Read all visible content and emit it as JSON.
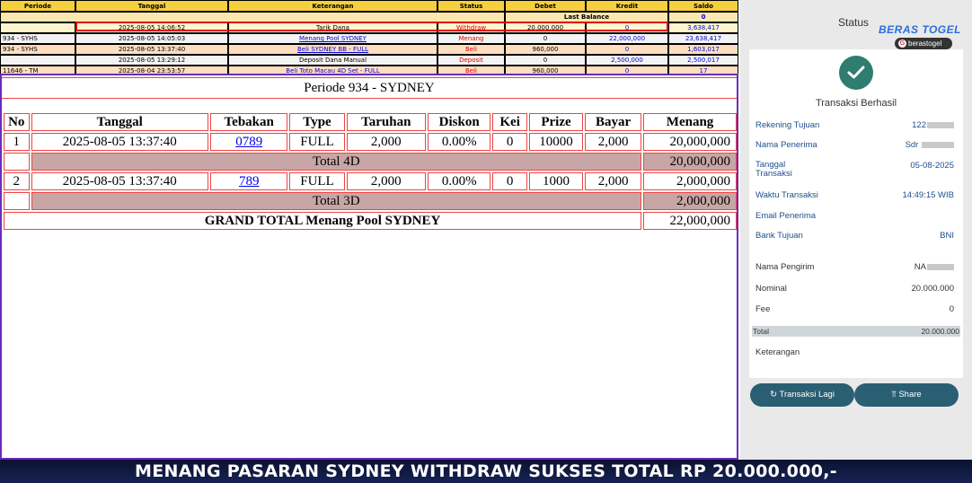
{
  "ledger": {
    "headers": [
      "Periode",
      "Tanggal",
      "Keterangan",
      "Status",
      "Debet",
      "Kredit",
      "Saldo"
    ],
    "last_balance_label": "Last Balance",
    "last_balance_value": "0",
    "rows": [
      {
        "periode": "",
        "tanggal": "2025-08-05 14:06:52",
        "keterangan": "Tarik Dana",
        "status": "Withdraw",
        "debet": "20,000,000",
        "kredit": "0",
        "saldo": "3,638,417"
      },
      {
        "periode": "934 - SYHS",
        "tanggal": "2025-08-05 14:05:03",
        "keterangan": "Menang Pool SYDNEY",
        "status": "Menang",
        "debet": "0",
        "kredit": "22,000,000",
        "saldo": "23,638,417"
      },
      {
        "periode": "934 - SYHS",
        "tanggal": "2025-08-05 13:37:40",
        "keterangan": "Beli SYDNEY BB - FULL",
        "status": "Beli",
        "debet": "960,000",
        "kredit": "0",
        "saldo": "1,603,017"
      },
      {
        "periode": "",
        "tanggal": "2025-08-05 13:29:12",
        "keterangan": "Deposit Dana Manual",
        "status": "Deposit",
        "debet": "0",
        "kredit": "2,500,000",
        "saldo": "2,500,017"
      },
      {
        "periode": "11646 - TM",
        "tanggal": "2025-08-04 23:53:57",
        "keterangan": "Beli Toto Macau 4D Set - FULL",
        "status": "Beli",
        "debet": "960,000",
        "kredit": "0",
        "saldo": "17"
      }
    ]
  },
  "report": {
    "title": "Periode 934 - SYDNEY",
    "headers": [
      "No",
      "Tanggal",
      "Tebakan",
      "Type",
      "Taruhan",
      "Diskon",
      "Kei",
      "Prize",
      "Bayar",
      "Menang"
    ],
    "row1": {
      "no": "1",
      "tanggal": "2025-08-05 13:37:40",
      "tebakan": "0789",
      "type": "FULL",
      "taruhan": "2,000",
      "diskon": "0.00%",
      "kei": "0",
      "prize": "10000",
      "bayar": "2,000",
      "menang": "20,000,000"
    },
    "total4d_label": "Total 4D",
    "total4d_value": "20,000,000",
    "row2": {
      "no": "2",
      "tanggal": "2025-08-05 13:37:40",
      "tebakan": "789",
      "type": "FULL",
      "taruhan": "2,000",
      "diskon": "0.00%",
      "kei": "0",
      "prize": "1000",
      "bayar": "2,000",
      "menang": "2,000,000"
    },
    "total3d_label": "Total 3D",
    "total3d_value": "2,000,000",
    "grand_label": "GRAND TOTAL  Menang Pool SYDNEY",
    "grand_value": "22,000,000"
  },
  "side": {
    "status_title": "Status",
    "brand": "BERAS TOGEL",
    "brand_pill": "berastogel",
    "success": "Transaksi Berhasil",
    "rekening_label": "Rekening Tujuan",
    "rekening_value": "122",
    "penerima_label": "Nama Penerima",
    "penerima_value": "Sdr",
    "tanggal_label": "Tanggal\nTransaksi",
    "tanggal_value": "05-08-2025",
    "waktu_label": "Waktu Transaksi",
    "waktu_value": "14:49:15 WIB",
    "email_label": "Email Penerima",
    "bank_label": "Bank Tujuan",
    "bank_value": "BNI",
    "pengirim_label": "Nama Pengirim",
    "pengirim_value": "NA",
    "nominal_label": "Nominal",
    "nominal_value": "20.000.000",
    "fee_label": "Fee",
    "fee_value": "0",
    "total_label": "Total",
    "total_value": "20.000.000",
    "keterangan_label": "Keterangan",
    "btn_again": "Transaksi Lagi",
    "btn_share": "Share"
  },
  "banner": "MENANG PASARAN SYDNEY WITHDRAW SUKSES TOTAL RP 20.000.000,-"
}
